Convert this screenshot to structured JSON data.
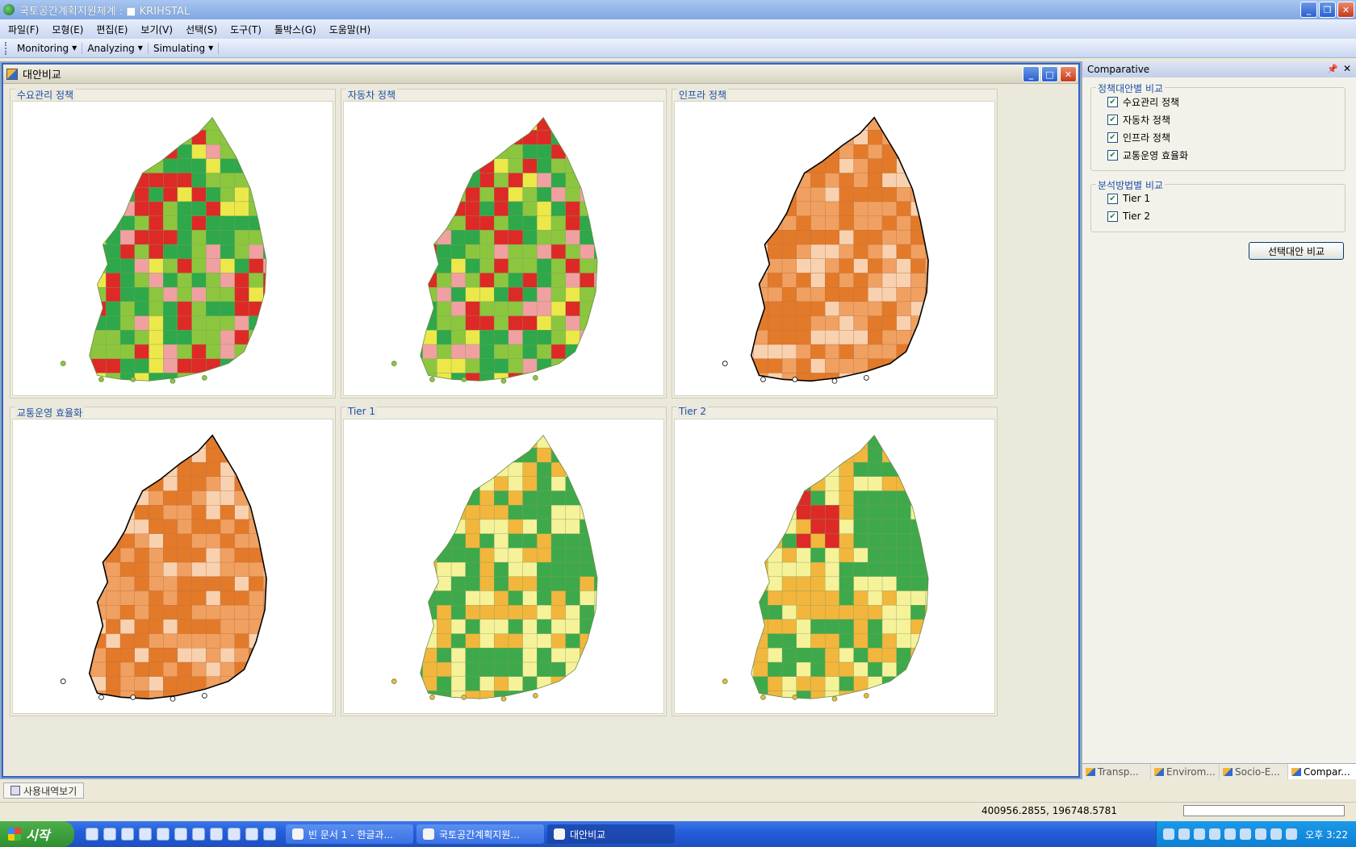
{
  "window": {
    "title": "국토공간계획지원체계 : ■ KRIHSTAL",
    "menu": [
      "파일(F)",
      "모형(E)",
      "편집(E)",
      "보기(V)",
      "선택(S)",
      "도구(T)",
      "툴박스(G)",
      "도움말(H)"
    ],
    "toolbar": [
      "Monitoring",
      "Analyzing",
      "Simulating"
    ]
  },
  "child": {
    "title": "대안비교",
    "maps": [
      {
        "title": "수요관리 정책",
        "scheme": "redgreen"
      },
      {
        "title": "자동차 정책",
        "scheme": "redgreen"
      },
      {
        "title": "인프라 정책",
        "scheme": "orange"
      },
      {
        "title": "교통운영 효율화",
        "scheme": "orange"
      },
      {
        "title": "Tier 1",
        "scheme": "yellowgreen"
      },
      {
        "title": "Tier 2",
        "scheme": "yellowgreen"
      }
    ]
  },
  "side": {
    "title": "Comparative",
    "group1": {
      "title": "정책대안별 비교",
      "items": [
        "수요관리 정책",
        "자동차 정책",
        "인프라 정책",
        "교통운영 효율화"
      ]
    },
    "group2": {
      "title": "분석방법별 비교",
      "items": [
        "Tier 1",
        "Tier 2"
      ]
    },
    "button": "선택대안 비교",
    "tabs": [
      "Transp...",
      "Envirom...",
      "Socio-E...",
      "Compar..."
    ]
  },
  "history_tab": "사용내역보기",
  "status": {
    "coords": "400956.2855,  196748.5781"
  },
  "taskbar": {
    "start": "시작",
    "tasks": [
      "빈 문서 1 - 한글과...",
      "국토공간계획지원...",
      "대안비교"
    ],
    "clock": "오후 3:22"
  },
  "colors": {
    "red": "#dd2a26",
    "pink": "#f0a0a0",
    "yellow": "#ece84a",
    "lightgreen": "#8cc63f",
    "green": "#2ea84a",
    "orange_dark": "#e27a2a",
    "orange_mid": "#f0a060",
    "orange_light": "#f8d2b0",
    "y_light": "#f6f29a",
    "y_orange": "#f2b63c",
    "y_green": "#3ea94a"
  }
}
